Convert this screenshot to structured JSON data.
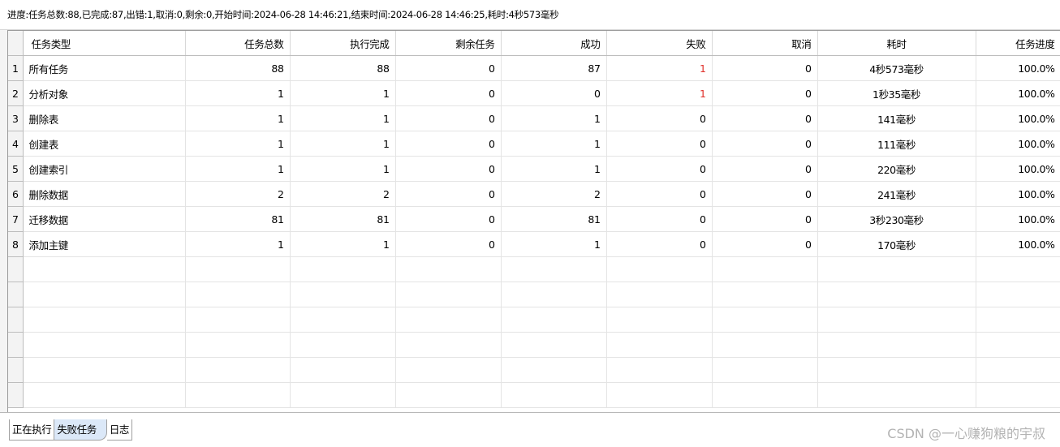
{
  "status": {
    "text": "进度:任务总数:88,已完成:87,出错:1,取消:0,剩余:0,开始时间:2024-06-28 14:46:21,结束时间:2024-06-28 14:46:25,耗时:4秒573毫秒"
  },
  "table": {
    "headers": [
      "任务类型",
      "任务总数",
      "执行完成",
      "剩余任务",
      "成功",
      "失败",
      "取消",
      "耗时",
      "任务进度"
    ],
    "rows": [
      {
        "num": "1",
        "type": "所有任务",
        "total": "88",
        "done": "88",
        "remaining": "0",
        "success": "87",
        "fail": "1",
        "cancel": "0",
        "time": "4秒573毫秒",
        "progress": "100.0%"
      },
      {
        "num": "2",
        "type": "分析对象",
        "total": "1",
        "done": "1",
        "remaining": "0",
        "success": "0",
        "fail": "1",
        "cancel": "0",
        "time": "1秒35毫秒",
        "progress": "100.0%"
      },
      {
        "num": "3",
        "type": "删除表",
        "total": "1",
        "done": "1",
        "remaining": "0",
        "success": "1",
        "fail": "0",
        "cancel": "0",
        "time": "141毫秒",
        "progress": "100.0%"
      },
      {
        "num": "4",
        "type": "创建表",
        "total": "1",
        "done": "1",
        "remaining": "0",
        "success": "1",
        "fail": "0",
        "cancel": "0",
        "time": "111毫秒",
        "progress": "100.0%"
      },
      {
        "num": "5",
        "type": "创建索引",
        "total": "1",
        "done": "1",
        "remaining": "0",
        "success": "1",
        "fail": "0",
        "cancel": "0",
        "time": "220毫秒",
        "progress": "100.0%"
      },
      {
        "num": "6",
        "type": "删除数据",
        "total": "2",
        "done": "2",
        "remaining": "0",
        "success": "2",
        "fail": "0",
        "cancel": "0",
        "time": "241毫秒",
        "progress": "100.0%"
      },
      {
        "num": "7",
        "type": "迁移数据",
        "total": "81",
        "done": "81",
        "remaining": "0",
        "success": "81",
        "fail": "0",
        "cancel": "0",
        "time": "3秒230毫秒",
        "progress": "100.0%"
      },
      {
        "num": "8",
        "type": "添加主键",
        "total": "1",
        "done": "1",
        "remaining": "0",
        "success": "1",
        "fail": "0",
        "cancel": "0",
        "time": "170毫秒",
        "progress": "100.0%"
      }
    ]
  },
  "tabs": [
    {
      "label": "正在执行",
      "active": false
    },
    {
      "label": "失败任务",
      "active": true
    },
    {
      "label": "日志",
      "active": false
    }
  ],
  "colors": {
    "fail_text": "#e0302a",
    "active_tab": "#dbe8f8"
  },
  "watermark": "CSDN @一心赚狗粮的宇叔"
}
